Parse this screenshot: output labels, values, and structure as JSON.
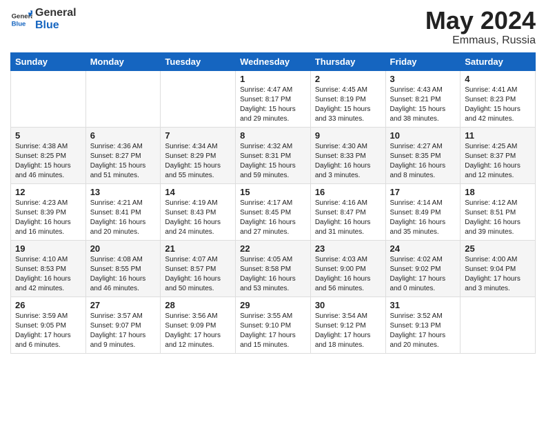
{
  "header": {
    "logo_general": "General",
    "logo_blue": "Blue",
    "month_title": "May 2024",
    "location": "Emmaus, Russia"
  },
  "days_of_week": [
    "Sunday",
    "Monday",
    "Tuesday",
    "Wednesday",
    "Thursday",
    "Friday",
    "Saturday"
  ],
  "weeks": [
    [
      {
        "day": "",
        "info": ""
      },
      {
        "day": "",
        "info": ""
      },
      {
        "day": "",
        "info": ""
      },
      {
        "day": "1",
        "info": "Sunrise: 4:47 AM\nSunset: 8:17 PM\nDaylight: 15 hours\nand 29 minutes."
      },
      {
        "day": "2",
        "info": "Sunrise: 4:45 AM\nSunset: 8:19 PM\nDaylight: 15 hours\nand 33 minutes."
      },
      {
        "day": "3",
        "info": "Sunrise: 4:43 AM\nSunset: 8:21 PM\nDaylight: 15 hours\nand 38 minutes."
      },
      {
        "day": "4",
        "info": "Sunrise: 4:41 AM\nSunset: 8:23 PM\nDaylight: 15 hours\nand 42 minutes."
      }
    ],
    [
      {
        "day": "5",
        "info": "Sunrise: 4:38 AM\nSunset: 8:25 PM\nDaylight: 15 hours\nand 46 minutes."
      },
      {
        "day": "6",
        "info": "Sunrise: 4:36 AM\nSunset: 8:27 PM\nDaylight: 15 hours\nand 51 minutes."
      },
      {
        "day": "7",
        "info": "Sunrise: 4:34 AM\nSunset: 8:29 PM\nDaylight: 15 hours\nand 55 minutes."
      },
      {
        "day": "8",
        "info": "Sunrise: 4:32 AM\nSunset: 8:31 PM\nDaylight: 15 hours\nand 59 minutes."
      },
      {
        "day": "9",
        "info": "Sunrise: 4:30 AM\nSunset: 8:33 PM\nDaylight: 16 hours\nand 3 minutes."
      },
      {
        "day": "10",
        "info": "Sunrise: 4:27 AM\nSunset: 8:35 PM\nDaylight: 16 hours\nand 8 minutes."
      },
      {
        "day": "11",
        "info": "Sunrise: 4:25 AM\nSunset: 8:37 PM\nDaylight: 16 hours\nand 12 minutes."
      }
    ],
    [
      {
        "day": "12",
        "info": "Sunrise: 4:23 AM\nSunset: 8:39 PM\nDaylight: 16 hours\nand 16 minutes."
      },
      {
        "day": "13",
        "info": "Sunrise: 4:21 AM\nSunset: 8:41 PM\nDaylight: 16 hours\nand 20 minutes."
      },
      {
        "day": "14",
        "info": "Sunrise: 4:19 AM\nSunset: 8:43 PM\nDaylight: 16 hours\nand 24 minutes."
      },
      {
        "day": "15",
        "info": "Sunrise: 4:17 AM\nSunset: 8:45 PM\nDaylight: 16 hours\nand 27 minutes."
      },
      {
        "day": "16",
        "info": "Sunrise: 4:16 AM\nSunset: 8:47 PM\nDaylight: 16 hours\nand 31 minutes."
      },
      {
        "day": "17",
        "info": "Sunrise: 4:14 AM\nSunset: 8:49 PM\nDaylight: 16 hours\nand 35 minutes."
      },
      {
        "day": "18",
        "info": "Sunrise: 4:12 AM\nSunset: 8:51 PM\nDaylight: 16 hours\nand 39 minutes."
      }
    ],
    [
      {
        "day": "19",
        "info": "Sunrise: 4:10 AM\nSunset: 8:53 PM\nDaylight: 16 hours\nand 42 minutes."
      },
      {
        "day": "20",
        "info": "Sunrise: 4:08 AM\nSunset: 8:55 PM\nDaylight: 16 hours\nand 46 minutes."
      },
      {
        "day": "21",
        "info": "Sunrise: 4:07 AM\nSunset: 8:57 PM\nDaylight: 16 hours\nand 50 minutes."
      },
      {
        "day": "22",
        "info": "Sunrise: 4:05 AM\nSunset: 8:58 PM\nDaylight: 16 hours\nand 53 minutes."
      },
      {
        "day": "23",
        "info": "Sunrise: 4:03 AM\nSunset: 9:00 PM\nDaylight: 16 hours\nand 56 minutes."
      },
      {
        "day": "24",
        "info": "Sunrise: 4:02 AM\nSunset: 9:02 PM\nDaylight: 17 hours\nand 0 minutes."
      },
      {
        "day": "25",
        "info": "Sunrise: 4:00 AM\nSunset: 9:04 PM\nDaylight: 17 hours\nand 3 minutes."
      }
    ],
    [
      {
        "day": "26",
        "info": "Sunrise: 3:59 AM\nSunset: 9:05 PM\nDaylight: 17 hours\nand 6 minutes."
      },
      {
        "day": "27",
        "info": "Sunrise: 3:57 AM\nSunset: 9:07 PM\nDaylight: 17 hours\nand 9 minutes."
      },
      {
        "day": "28",
        "info": "Sunrise: 3:56 AM\nSunset: 9:09 PM\nDaylight: 17 hours\nand 12 minutes."
      },
      {
        "day": "29",
        "info": "Sunrise: 3:55 AM\nSunset: 9:10 PM\nDaylight: 17 hours\nand 15 minutes."
      },
      {
        "day": "30",
        "info": "Sunrise: 3:54 AM\nSunset: 9:12 PM\nDaylight: 17 hours\nand 18 minutes."
      },
      {
        "day": "31",
        "info": "Sunrise: 3:52 AM\nSunset: 9:13 PM\nDaylight: 17 hours\nand 20 minutes."
      },
      {
        "day": "",
        "info": ""
      }
    ]
  ]
}
